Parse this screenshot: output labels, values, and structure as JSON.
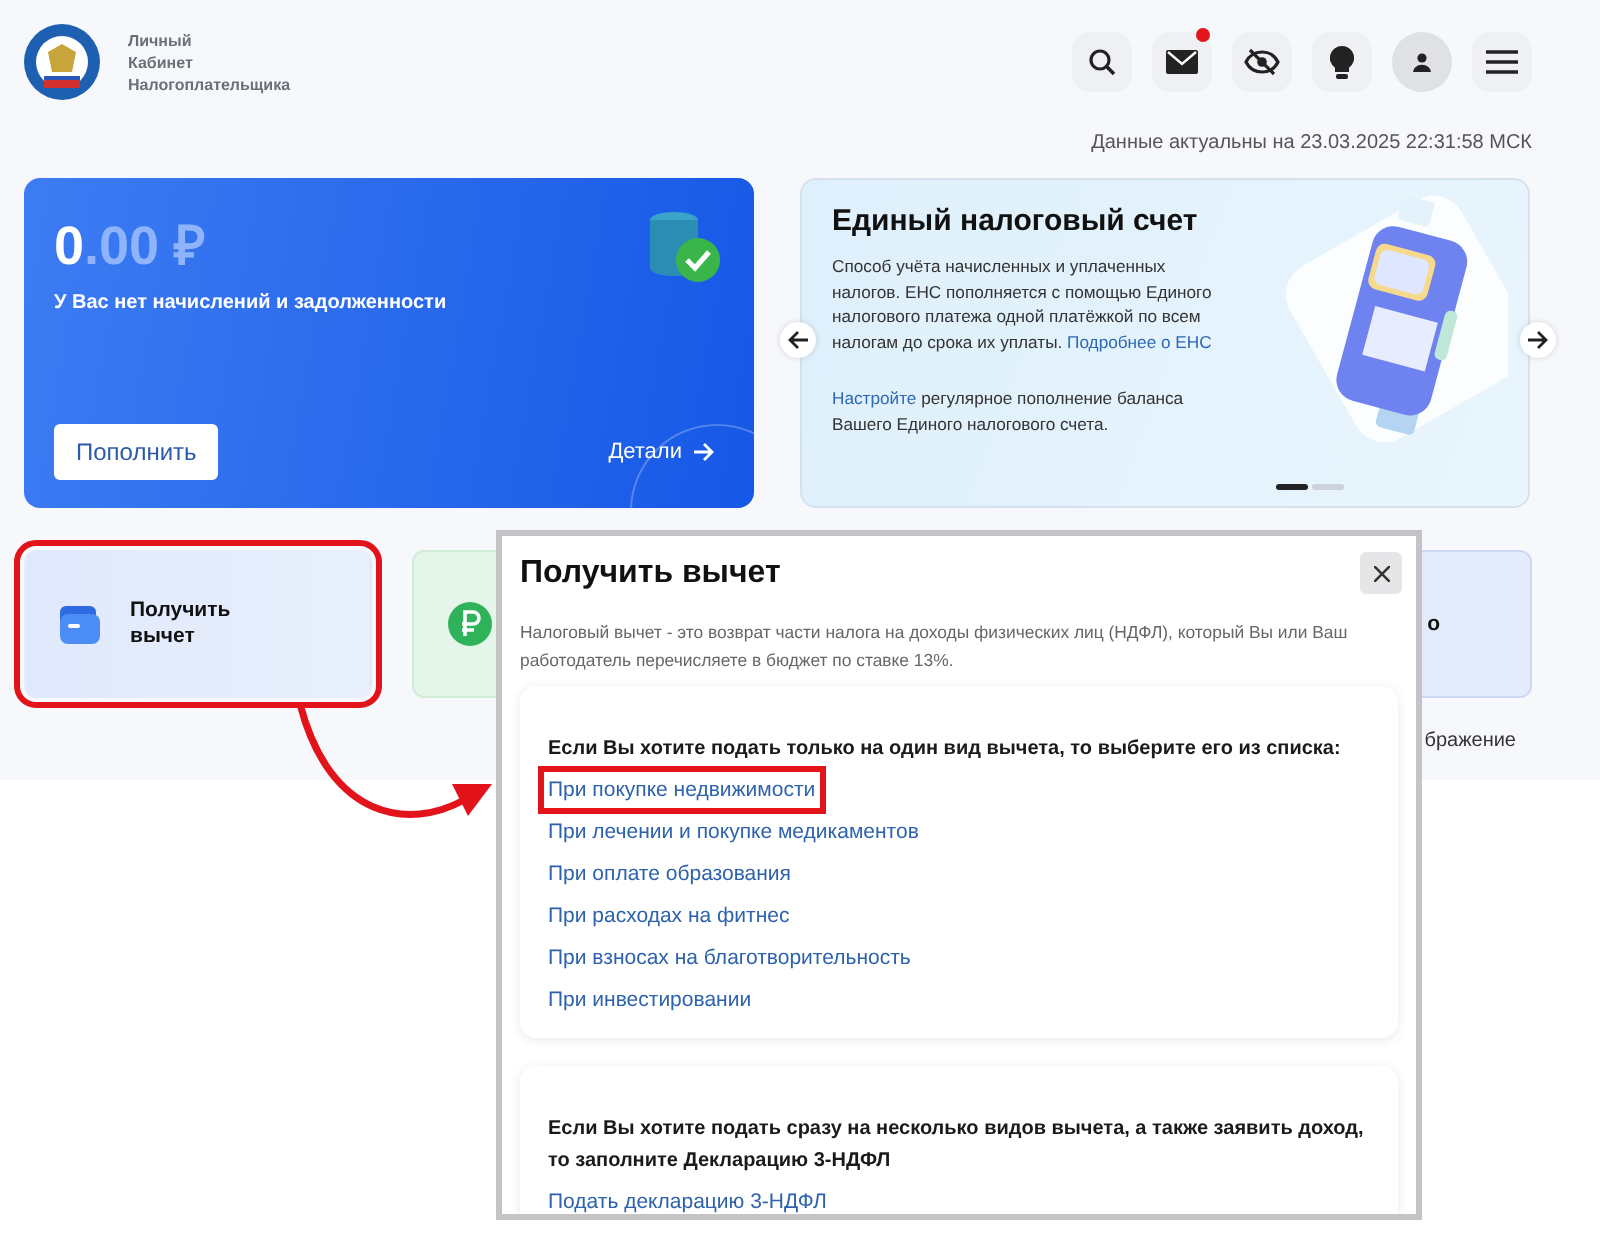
{
  "header": {
    "logo_lines": [
      "Личный",
      "Кабинет",
      "Налогоплательщика"
    ],
    "toolbar": [
      {
        "kind": "search",
        "badge": false,
        "selected": false
      },
      {
        "kind": "mail",
        "badge": true,
        "selected": false
      },
      {
        "kind": "eye-off",
        "badge": false,
        "selected": false
      },
      {
        "kind": "bulb",
        "badge": false,
        "selected": false
      },
      {
        "kind": "user",
        "badge": false,
        "selected": true
      },
      {
        "kind": "menu",
        "badge": false,
        "selected": false
      }
    ]
  },
  "updated": "Данные актуальны на 23.03.2025 22:31:58 МСК",
  "balance_card": {
    "amount_whole": "0",
    "amount_fraction": ".00 ₽",
    "message": "У Вас нет начислений и задолженности",
    "button": "Пополнить",
    "details_link": "Детали"
  },
  "ens_card": {
    "title": "Единый налоговый счет",
    "text": "Способ учёта начисленных и уплаченных налогов. ЕНС пополняется с помощью Единого налогового платежа одной платёжкой по всем налогам до срока их уплаты.",
    "more_link": "Подробнее о ЕНС",
    "setup_link": "Настройте",
    "setup_text": "регулярное пополнение баланса Вашего Единого налогового счета.",
    "dots": [
      {
        "selected": true
      },
      {
        "selected": false
      }
    ]
  },
  "tiles": [
    {
      "kind": "wallet",
      "label": "Получить вычет",
      "highlighted": true
    },
    {
      "kind": "ruble",
      "highlighted": false
    },
    {
      "kind": "cut",
      "label": "о",
      "highlighted": false
    }
  ],
  "side_text": "бражение",
  "modal": {
    "title": "Получить вычет",
    "description": "Налоговый вычет - это возврат части налога на доходы физических лиц (НДФЛ), который Вы или Ваш работодатель перечисляете в бюджет по ставке 13%.",
    "sections": [
      {
        "heading": "Если Вы хотите подать только на один вид вычета, то выберите его из списка:",
        "links": [
          {
            "label": "При покупке недвижимости",
            "highlighted": true
          },
          {
            "label": "При лечении и покупке медикаментов",
            "highlighted": false
          },
          {
            "label": "При оплате образования",
            "highlighted": false
          },
          {
            "label": "При расходах на фитнес",
            "highlighted": false
          },
          {
            "label": "При взносах на благотворительность",
            "highlighted": false
          },
          {
            "label": "При инвестировании",
            "highlighted": false
          }
        ]
      },
      {
        "heading": "Если Вы хотите подать сразу на несколько видов вычета, а также заявить доход, то заполните Декларацию 3-НДФЛ",
        "links": [
          {
            "label": "Подать декларацию 3-НДФЛ",
            "highlighted": false
          }
        ]
      }
    ]
  }
}
